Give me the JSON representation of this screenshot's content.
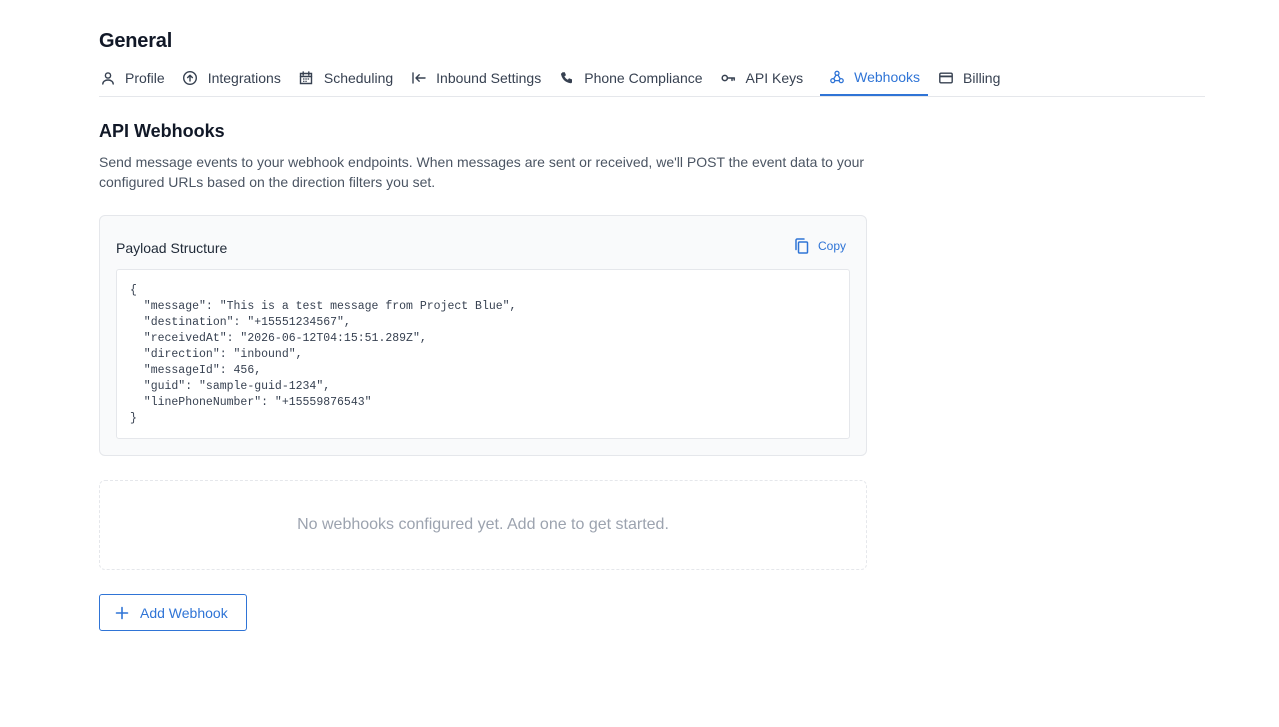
{
  "page": {
    "title": "General"
  },
  "tabs": [
    {
      "label": "Profile",
      "icon": "user-icon"
    },
    {
      "label": "Integrations",
      "icon": "upload-circle-icon"
    },
    {
      "label": "Scheduling",
      "icon": "calendar-icon"
    },
    {
      "label": "Inbound Settings",
      "icon": "arrow-left-bar-icon"
    },
    {
      "label": "Phone Compliance",
      "icon": "phone-icon"
    },
    {
      "label": "API Keys",
      "icon": "key-icon"
    },
    {
      "label": "Webhooks",
      "icon": "webhook-icon",
      "active": true
    },
    {
      "label": "Billing",
      "icon": "credit-card-icon"
    }
  ],
  "section": {
    "title": "API Webhooks",
    "description": "Send message events to your webhook endpoints. When messages are sent or received, we'll POST the event data to your configured URLs based on the direction filters you set."
  },
  "payload": {
    "title": "Payload Structure",
    "copy_label": "Copy",
    "code_lines": [
      "{",
      "  \"message\": \"This is a test message from Project Blue\",",
      "  \"destination\": \"+15551234567\",",
      "  \"receivedAt\": \"2026-06-12T04:15:51.289Z\",",
      "  \"direction\": \"inbound\",",
      "  \"messageId\": 456,",
      "  \"guid\": \"sample-guid-1234\",",
      "  \"linePhoneNumber\": \"+15559876543\"",
      "}"
    ]
  },
  "empty_state": {
    "text": "No webhooks configured yet. Add one to get started."
  },
  "add_button": {
    "label": "Add Webhook"
  },
  "colors": {
    "accent": "#2f74d6",
    "muted": "#9ca3af",
    "border": "#e5e7eb"
  }
}
